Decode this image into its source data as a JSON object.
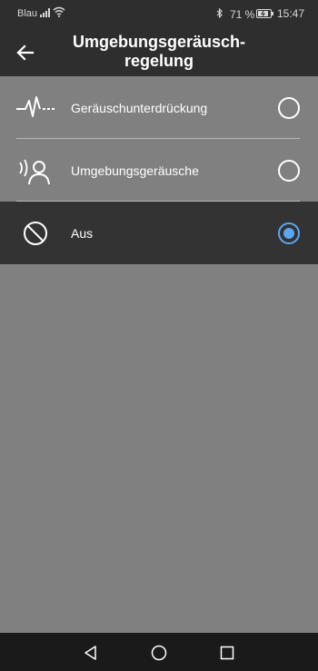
{
  "status_bar": {
    "carrier": "Blau",
    "battery_percent": "71 %",
    "time": "15:47",
    "icons": [
      "signal-icon",
      "wifi-icon",
      "bluetooth-icon",
      "battery-icon"
    ]
  },
  "header": {
    "title": "Umgebungsgeräusch-regelung",
    "back_icon": "arrow-left-icon"
  },
  "options": [
    {
      "label": "Geräuschunterdrückung",
      "icon": "noise-cancelling-icon",
      "selected": false
    },
    {
      "label": "Umgebungsgeräusche",
      "icon": "ambient-sound-icon",
      "selected": false
    },
    {
      "label": "Aus",
      "icon": "off-icon",
      "selected": true
    }
  ],
  "nav_bar": {
    "icons": [
      "back-triangle-icon",
      "home-circle-icon",
      "recents-square-icon"
    ]
  },
  "colors": {
    "accent": "#5aa7f0",
    "header_bg": "#2e2e2e",
    "content_bg": "#808080",
    "selected_row_bg": "#333333",
    "nav_bg": "#1a1a1a"
  }
}
